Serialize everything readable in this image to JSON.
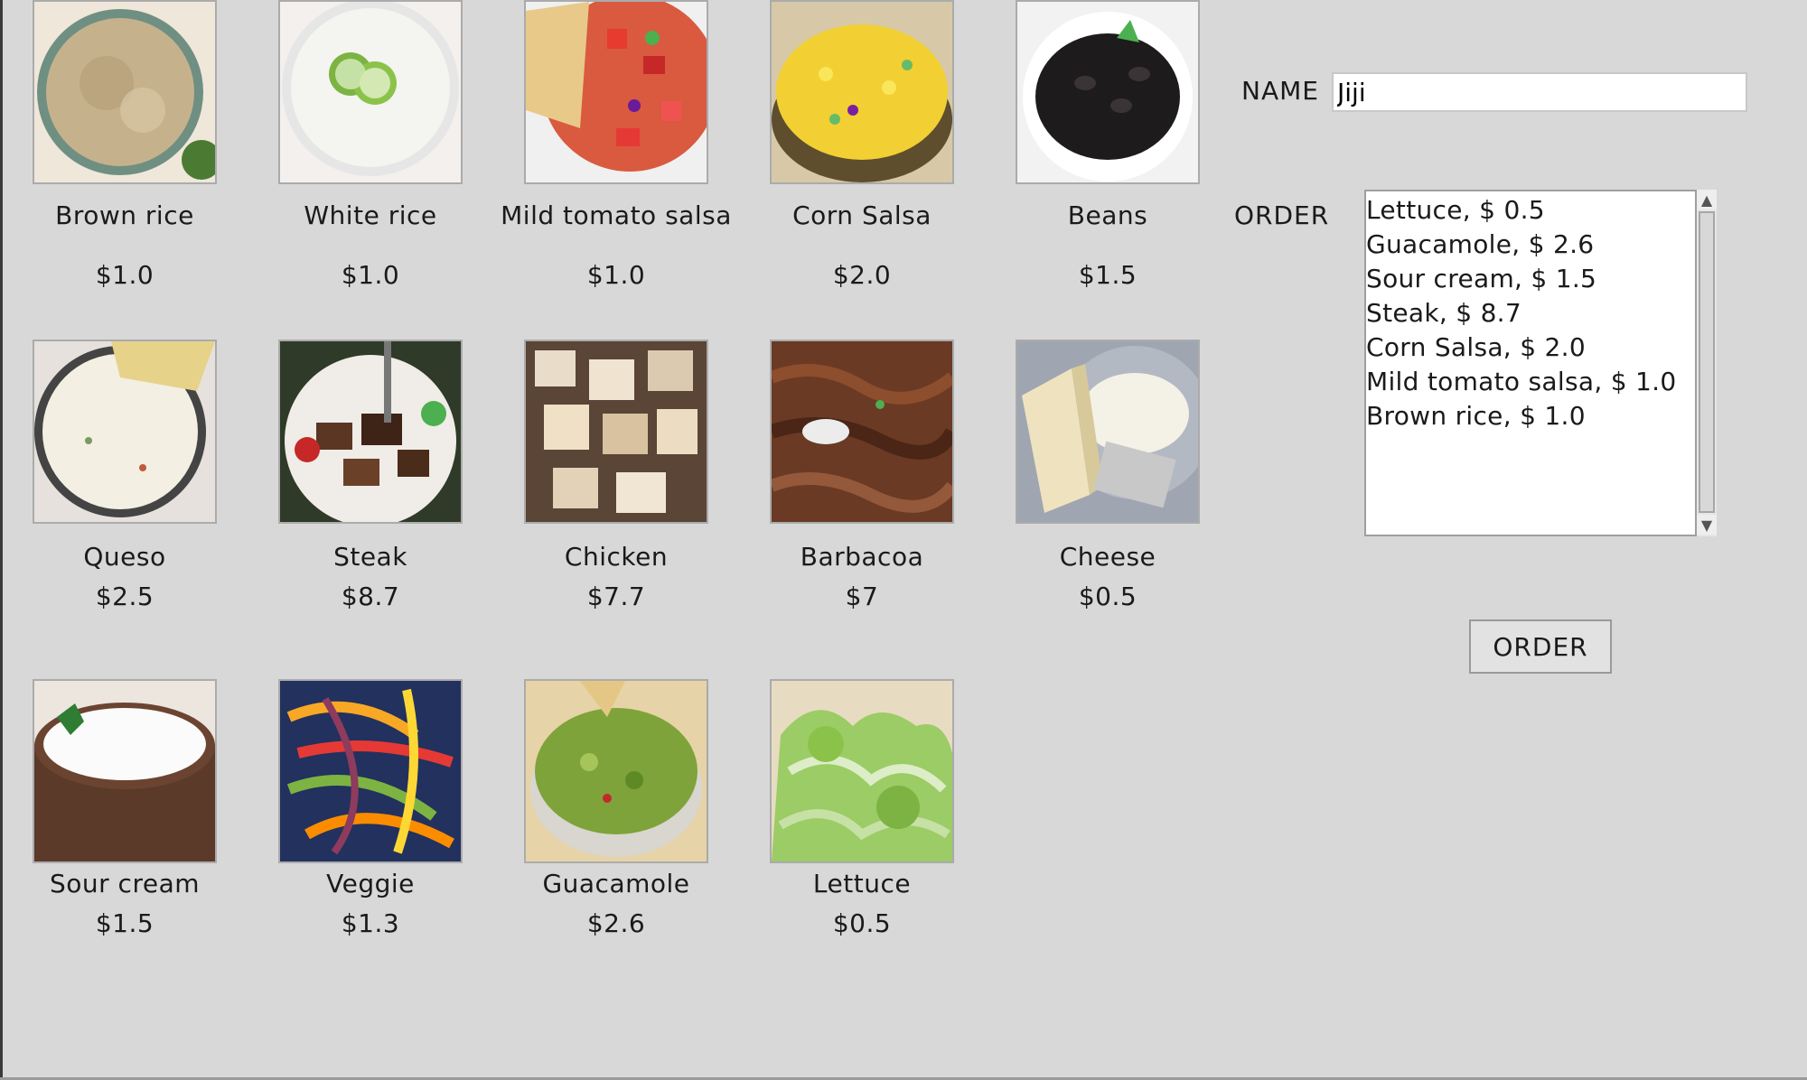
{
  "menu": {
    "items": [
      {
        "name": "Brown rice",
        "price": "$1.0",
        "icon": "brown-rice-photo"
      },
      {
        "name": "White rice",
        "price": "$1.0",
        "icon": "white-rice-photo"
      },
      {
        "name": "Mild tomato salsa",
        "price": "$1.0",
        "icon": "tomato-salsa-photo"
      },
      {
        "name": "Corn Salsa",
        "price": "$2.0",
        "icon": "corn-salsa-photo"
      },
      {
        "name": "Beans",
        "price": "$1.5",
        "icon": "beans-photo"
      },
      {
        "name": "Queso",
        "price": "$2.5",
        "icon": "queso-photo"
      },
      {
        "name": "Steak",
        "price": "$8.7",
        "icon": "steak-photo"
      },
      {
        "name": "Chicken",
        "price": "$7.7",
        "icon": "chicken-photo"
      },
      {
        "name": "Barbacoa",
        "price": "$7",
        "icon": "barbacoa-photo"
      },
      {
        "name": "Cheese",
        "price": "$0.5",
        "icon": "cheese-photo"
      },
      {
        "name": "Sour cream",
        "price": "$1.5",
        "icon": "sour-cream-photo"
      },
      {
        "name": "Veggie",
        "price": "$1.3",
        "icon": "veggie-photo"
      },
      {
        "name": "Guacamole",
        "price": "$2.6",
        "icon": "guacamole-photo"
      },
      {
        "name": "Lettuce",
        "price": "$0.5",
        "icon": "lettuce-photo"
      }
    ]
  },
  "form": {
    "name_label": "NAME",
    "name_value": "Jiji",
    "order_label": "ORDER",
    "order_items": [
      "Lettuce, $ 0.5",
      "Guacamole, $ 2.6",
      "Sour cream, $ 1.5",
      "Steak, $ 8.7",
      "Corn Salsa, $ 2.0",
      "Mild tomato salsa, $ 1.0",
      "Brown rice, $ 1.0"
    ],
    "order_button": "ORDER"
  }
}
